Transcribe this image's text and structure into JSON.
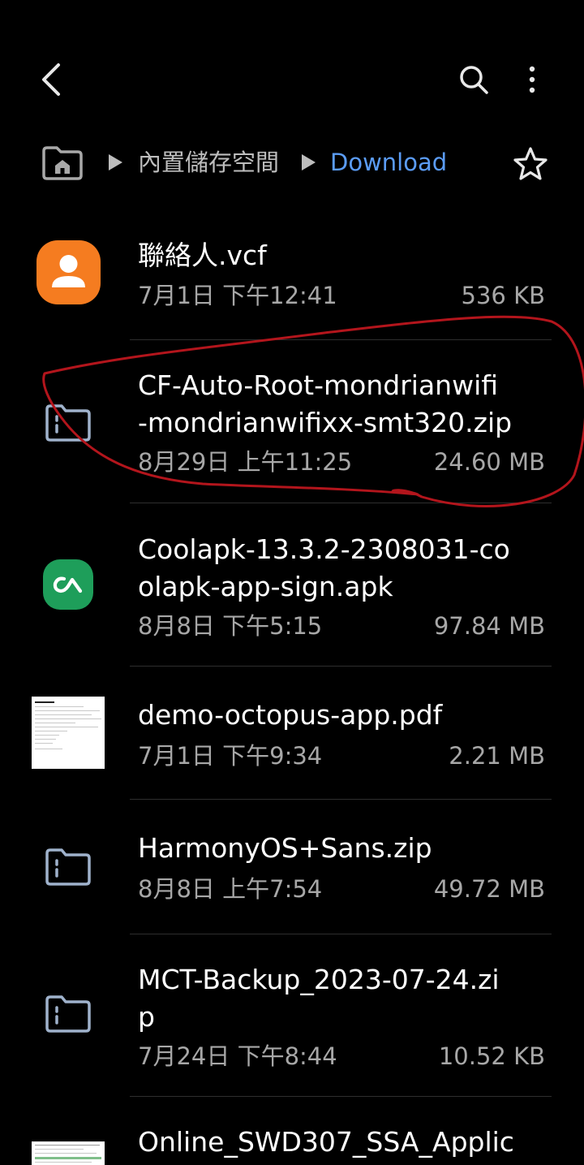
{
  "header": {
    "back_icon": "back-arrow-icon",
    "search_icon": "search-icon",
    "more_icon": "more-vert-icon"
  },
  "breadcrumb": {
    "home_icon": "home-folder-icon",
    "items": [
      "內置儲存空間",
      "Download"
    ],
    "star_icon": "star-outline-icon",
    "active_color": "#5b9cf5"
  },
  "files": [
    {
      "name": "聯絡人.vcf",
      "date": "7月1日 下午12:41",
      "size": "536 KB",
      "icon": "contact-icon",
      "icon_color": "#f57c20"
    },
    {
      "name_lines": [
        "CF-Auto-Root-mondrianwifi",
        "-mondrianwifixx-smt320.zip"
      ],
      "date": "8月29日 上午11:25",
      "size": "24.60 MB",
      "icon": "zip-folder-icon"
    },
    {
      "name_lines": [
        "Coolapk-13.3.2-2308031-co",
        "olapk-app-sign.apk"
      ],
      "date": "8月8日 下午5:15",
      "size": "97.84 MB",
      "icon": "coolapk-app-icon",
      "icon_color": "#1e9e5a"
    },
    {
      "name": "demo-octopus-app.pdf",
      "date": "7月1日 下午9:34",
      "size": "2.21 MB",
      "icon": "pdf-thumbnail"
    },
    {
      "name": "HarmonyOS+Sans.zip",
      "date": "8月8日 上午7:54",
      "size": "49.72 MB",
      "icon": "zip-folder-icon"
    },
    {
      "name_lines": [
        "MCT-Backup_2023-07-24.zi",
        "p"
      ],
      "date": "7月24日 下午8:44",
      "size": "10.52 KB",
      "icon": "zip-folder-icon"
    },
    {
      "name": "Online_SWD307_SSA_Applic",
      "icon": "document-thumbnail"
    }
  ],
  "annotation": {
    "color": "#b3151c"
  }
}
